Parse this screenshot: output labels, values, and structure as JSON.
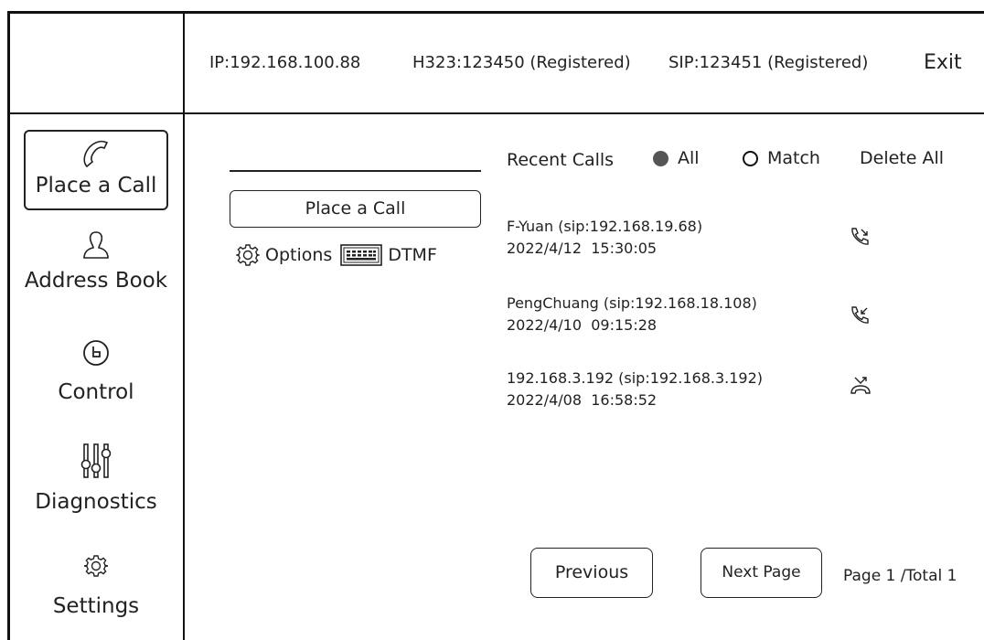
{
  "header": {
    "ip": "IP:192.168.100.88",
    "h323": "H323:123450 (Registered)",
    "sip": "SIP:123451 (Registered)",
    "exit_label": "Exit"
  },
  "sidebar": {
    "items": [
      {
        "label": "Place a Call",
        "icon": "phone-icon",
        "active": true
      },
      {
        "label": "Address Book",
        "icon": "person-icon"
      },
      {
        "label": "Control",
        "icon": "clock-icon"
      },
      {
        "label": "Diagnostics",
        "icon": "sliders-icon"
      },
      {
        "label": "Settings",
        "icon": "gear-icon"
      }
    ]
  },
  "dial": {
    "input_value": "",
    "place_call_label": "Place a Call",
    "options_label": "Options",
    "dtmf_label": "DTMF"
  },
  "recent": {
    "title": "Recent Calls",
    "filter_all": "All",
    "filter_match": "Match",
    "selected_filter": "All",
    "delete_all": "Delete All",
    "calls": [
      {
        "name": "F-Yuan (sip:192.168.19.68)",
        "time": "2022/4/12  15:30:05",
        "icon": "outgoing-call-icon"
      },
      {
        "name": "PengChuang (sip:192.168.18.108)",
        "time": "2022/4/10  09:15:28",
        "icon": "incoming-call-icon"
      },
      {
        "name": "192.168.3.192 (sip:192.168.3.192)",
        "time": "2022/4/08  16:58:52",
        "icon": "missed-call-icon"
      }
    ]
  },
  "pagination": {
    "previous": "Previous",
    "next": "Next Page",
    "info": "Page 1 /Total 1"
  }
}
